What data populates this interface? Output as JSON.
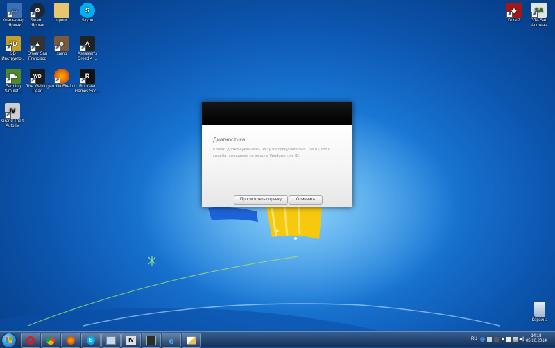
{
  "desktop": {
    "icons_left": [
      {
        "label": "Компьютер - Ярлык",
        "icon": "computer-icon",
        "color": "#3b6fb8"
      },
      {
        "label": "Steam - Ярлык",
        "icon": "steam-icon",
        "color": "#1b2838"
      },
      {
        "label": "проги",
        "icon": "folder-icon",
        "color": "#e9c66b"
      },
      {
        "label": "Skype",
        "icon": "skype-icon",
        "color": "#00aff0"
      },
      {
        "label": "3D Инструкто...",
        "icon": "3d-instructor-icon",
        "color": "#c8a020"
      },
      {
        "label": "Driver San Francisco",
        "icon": "driver-sf-icon",
        "color": "#333333"
      },
      {
        "label": "samp",
        "icon": "samp-icon",
        "color": "#7a5a3a"
      },
      {
        "label": "Assassin's Creed 4 ...",
        "icon": "assassins-creed-icon",
        "color": "#222222"
      },
      {
        "label": "Farming Simulat...",
        "icon": "farming-sim-icon",
        "color": "#4d8a2a"
      },
      {
        "label": "The Walking Dead",
        "icon": "walking-dead-icon",
        "color": "#1a1a1a"
      },
      {
        "label": "Mozilla Firefox",
        "icon": "firefox-icon",
        "color": "#e66000"
      },
      {
        "label": "Rockstar Games Soc...",
        "icon": "rockstar-icon",
        "color": "#111111"
      },
      {
        "label": "Grand Theft Auto IV",
        "icon": "gta4-icon",
        "color": "#cfcfcf"
      }
    ],
    "icons_right": [
      {
        "label": "Dota 2",
        "icon": "dota2-icon",
        "color": "#a01818"
      },
      {
        "label": "GTA San Andreas",
        "icon": "gta-sa-icon",
        "color": "#dfe8df"
      }
    ],
    "recycle_bin": {
      "label": "Корзина",
      "icon": "recycle-bin-icon"
    }
  },
  "dialog": {
    "title": "Диагностика",
    "message": "Клиент должен указывать на ту же среду Windows Live ID, что и служба помощника по входу в Windows Live ID.",
    "help_button": "Просмотреть справку",
    "cancel_button": "Отменить"
  },
  "taskbar": {
    "pinned": [
      {
        "icon": "opera-icon"
      },
      {
        "icon": "chrome-icon"
      },
      {
        "icon": "firefox-icon"
      },
      {
        "icon": "skype-icon"
      },
      {
        "icon": "network-app-icon"
      },
      {
        "icon": "gta4-icon"
      },
      {
        "icon": "gta-sa-icon"
      },
      {
        "icon": "internet-explorer-icon"
      },
      {
        "icon": "paint-icon"
      }
    ],
    "tray": {
      "language": "RU",
      "time": "14:18",
      "date": "05.10.2014"
    }
  },
  "colors": {
    "desktop_accent": "#1a79d6",
    "dialog_header": "#000000",
    "taskbar": "#2a4d7a"
  }
}
